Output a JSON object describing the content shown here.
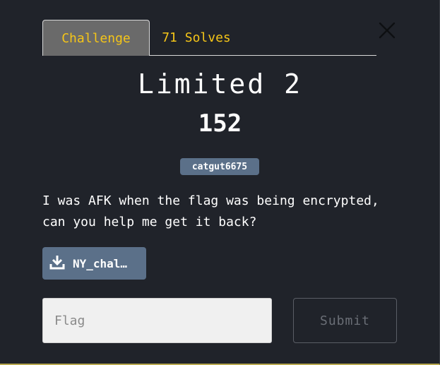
{
  "tabs": [
    {
      "label": "Challenge"
    },
    {
      "label": "71 Solves"
    }
  ],
  "challenge": {
    "name": "Limited 2",
    "points": "152",
    "author_tag": "catgut6675",
    "description": "I was AFK when the flag was being encrypted, can you help me get it back?",
    "file": {
      "name": "NY_chal…",
      "icon": "download-icon"
    }
  },
  "form": {
    "flag_placeholder": "Flag",
    "flag_value": "",
    "submit_label": "Submit"
  },
  "colors": {
    "background": "#20232a",
    "accent": "#f5c518",
    "tag": "#5b7089"
  }
}
